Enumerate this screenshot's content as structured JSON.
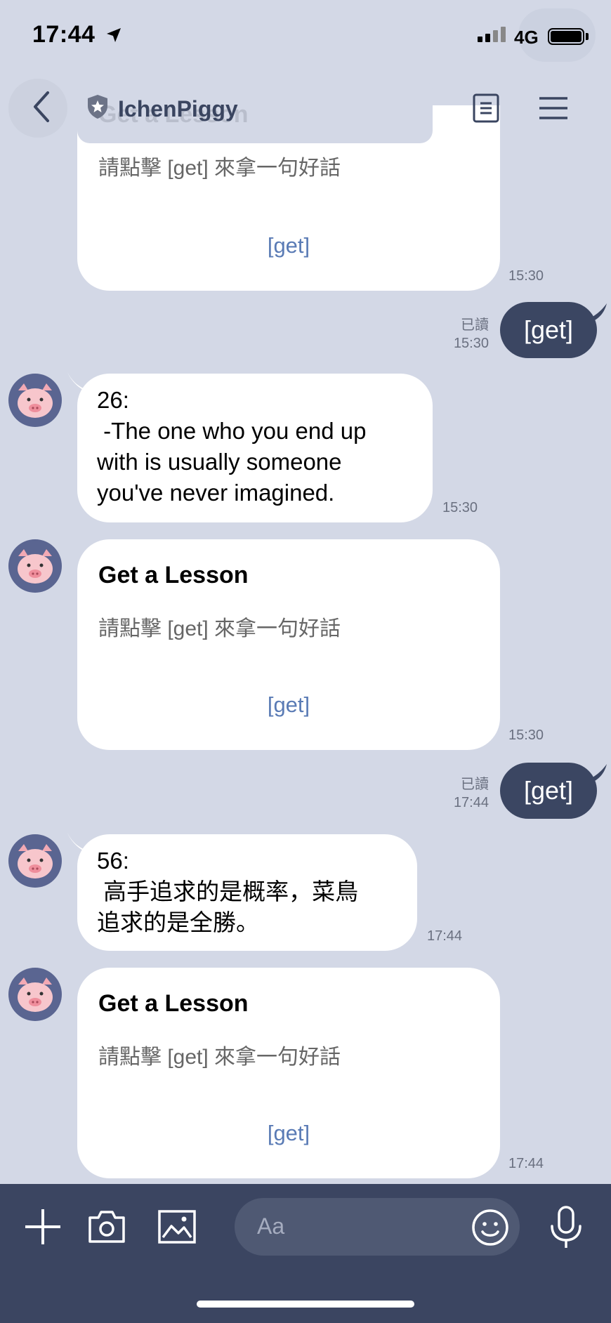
{
  "status": {
    "time": "17:44",
    "network": "4G"
  },
  "header": {
    "title": "IchenPiggy",
    "ghost_title": "Get a Lesson"
  },
  "card_top": {
    "subtitle": "請點擊 [get] 來拿一句好話",
    "action": "[get]",
    "time": "15:30"
  },
  "out1": {
    "read": "已讀",
    "time": "15:30",
    "text": "[get]"
  },
  "in1": {
    "text": "26:\n -The one who you end up\nwith is usually someone\nyou've never imagined.",
    "time": "15:30"
  },
  "card2": {
    "title": "Get a Lesson",
    "subtitle": "請點擊 [get] 來拿一句好話",
    "action": "[get]",
    "time": "15:30"
  },
  "out2": {
    "read": "已讀",
    "time": "17:44",
    "text": "[get]"
  },
  "in2": {
    "text": "56:\n 高手追求的是概率，菜鳥\n追求的是全勝。",
    "time": "17:44"
  },
  "card3": {
    "title": "Get a Lesson",
    "subtitle": "請點擊 [get] 來拿一句好話",
    "action": "[get]",
    "time": "17:44"
  },
  "composer": {
    "placeholder": "Aa"
  },
  "colors": {
    "background": "#d3d8e6",
    "bar": "#3b4561",
    "sent_bubble": "#3b4662",
    "link": "#5a7bb5"
  }
}
